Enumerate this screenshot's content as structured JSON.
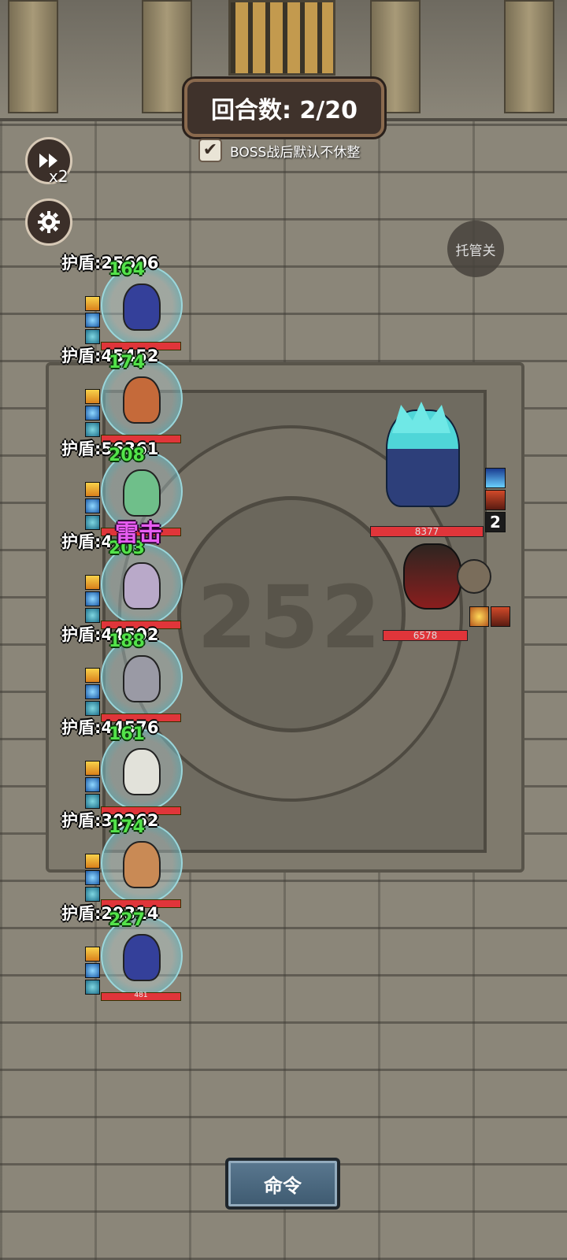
{
  "hud": {
    "round_label": "回合数: 2/20",
    "boss_no_rest_label": "BOSS战后默认不休整",
    "boss_no_rest_checked": true,
    "speed_label": "x2",
    "auto_label": "托管关",
    "command_label": "命令"
  },
  "floor_number": "252",
  "skill_popup": "雷击",
  "heroes": [
    {
      "shield": "护盾:25606",
      "heal": "164",
      "color": "#34409a"
    },
    {
      "shield": "护盾:45452",
      "heal": "174",
      "color": "#c56a3a"
    },
    {
      "shield": "护盾:56361",
      "heal": "208",
      "color": "#6fbf8a"
    },
    {
      "shield": "护盾:4",
      "heal": "203",
      "color": "#b9a9c9"
    },
    {
      "shield": "护盾:44502",
      "heal": "188",
      "color": "#9a9aa5"
    },
    {
      "shield": "护盾:44576",
      "heal": "161",
      "color": "#e2e2da"
    },
    {
      "shield": "护盾:30262",
      "heal": "174",
      "color": "#c98a55"
    },
    {
      "shield": "护盾:29314",
      "heal": "227",
      "color": "#34409a",
      "hp": "481"
    }
  ],
  "enemies": [
    {
      "name": "ice-golem",
      "hp": "8377",
      "stack": "2"
    },
    {
      "name": "imp-warrior",
      "hp": "6578"
    }
  ],
  "colors": {
    "heal_text": "#53e34a",
    "skill_text": "#e85df2",
    "hp_bar": "#e0353a",
    "command_button": "#4a6a82"
  },
  "icons": {
    "speed": "fast-forward-icon",
    "settings": "gear-icon",
    "checkbox": "checkmark-icon"
  }
}
